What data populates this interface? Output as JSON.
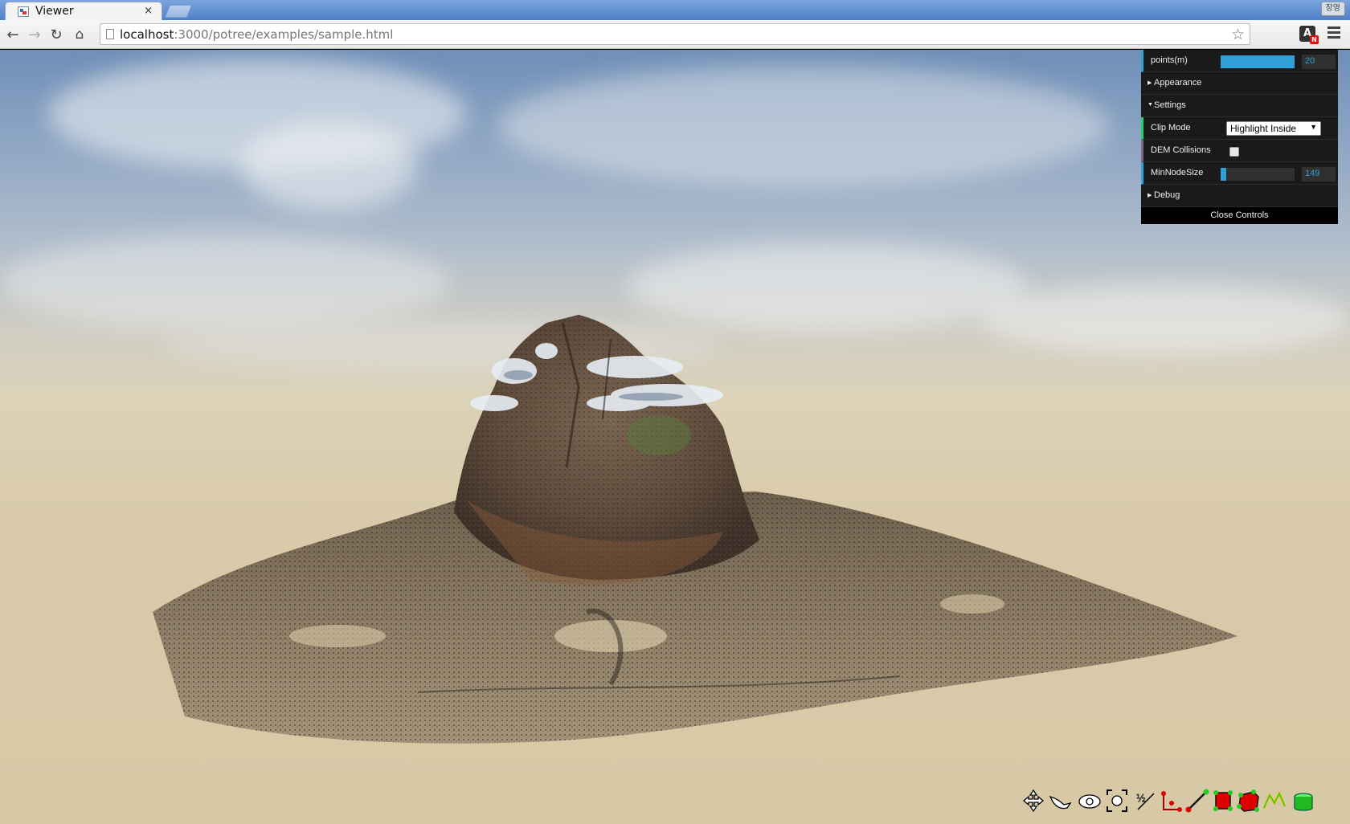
{
  "browser": {
    "tab_title": "Viewer",
    "tab_close": "×",
    "profile_label": "장영",
    "url_host": "localhost",
    "url_rest": ":3000/potree/examples/sample.html",
    "ext_letter": "A",
    "ext_badge": "N"
  },
  "gui": {
    "points": {
      "label": "points(m)",
      "value": "20",
      "fraction": 1.0
    },
    "folders": {
      "appearance": "Appearance",
      "settings": "Settings",
      "debug": "Debug"
    },
    "clip_mode": {
      "label": "Clip Mode",
      "value": "Highlight Inside"
    },
    "dem_collisions": {
      "label": "DEM Collisions",
      "checked": false
    },
    "min_node_size": {
      "label": "MinNodeSize",
      "value": "149",
      "fraction": 0.08
    },
    "close_label": "Close Controls"
  },
  "toolbar": {
    "tools": [
      "move-tool-icon",
      "fly-tool-icon",
      "orbit-tool-icon",
      "focus-tool-icon",
      "angle-measure-icon",
      "point-measure-icon",
      "distance-measure-icon",
      "area-measure-icon",
      "volume-measure-icon",
      "height-profile-icon",
      "clip-volume-icon"
    ]
  }
}
